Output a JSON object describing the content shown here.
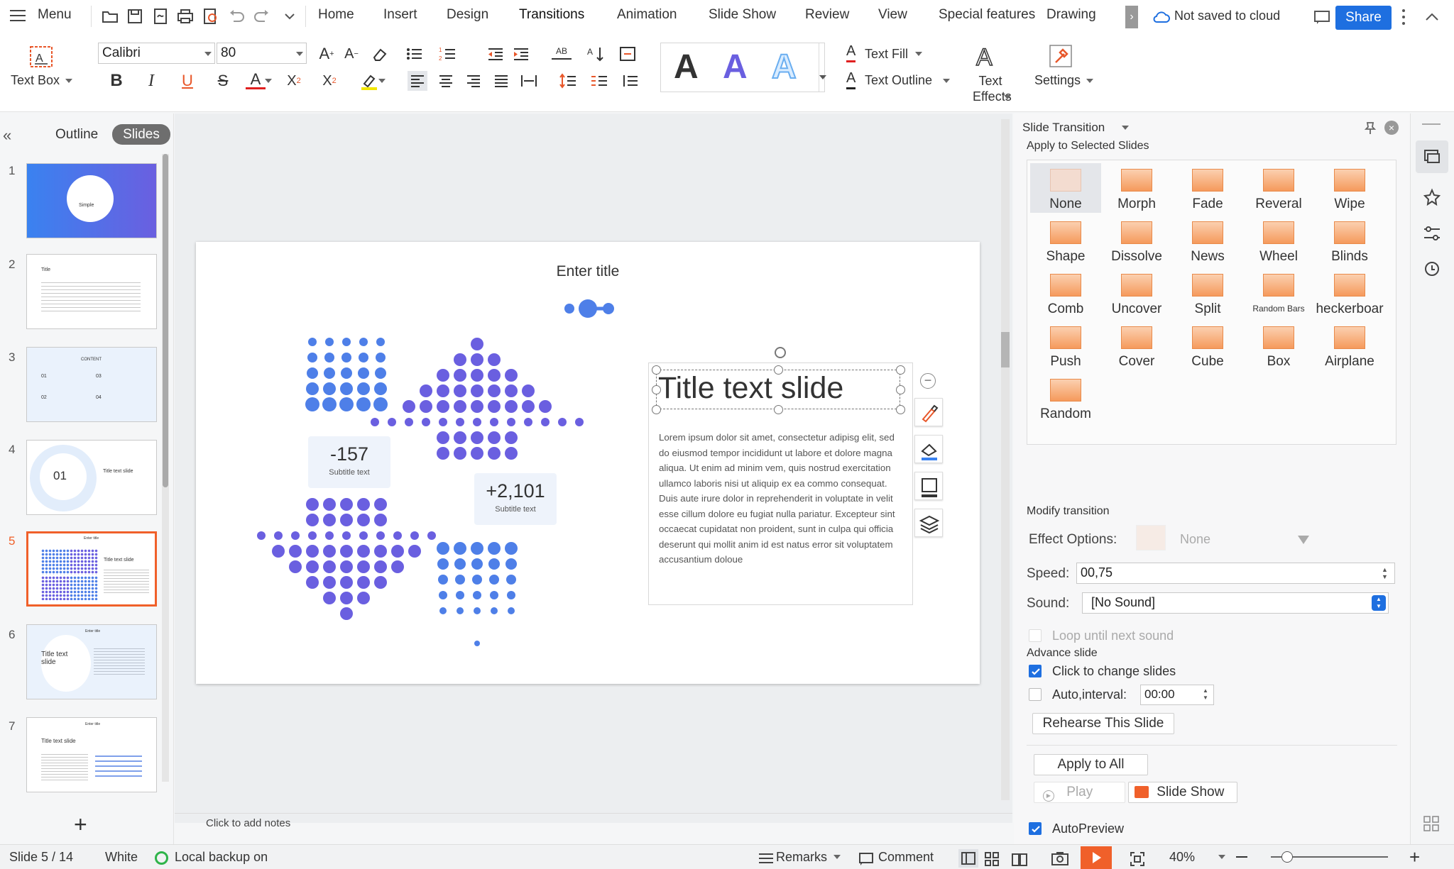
{
  "topbar": {
    "menu_label": "Menu",
    "tabs": [
      "Home",
      "Insert",
      "Design",
      "Transitions",
      "Animation",
      "Slide Show",
      "Review",
      "View",
      "Special features",
      "Drawing"
    ],
    "cloud_status": "Not saved to cloud",
    "share_label": "Share"
  },
  "ribbon": {
    "textbox_label": "Text Box",
    "font_name": "Calibri",
    "font_size": "80",
    "text_fill_label": "Text Fill",
    "text_outline_label": "Text Outline",
    "text_effects_label": "Text Effects",
    "settings_label": "Settings",
    "wordart_sample": "A"
  },
  "leftpanel": {
    "tab_outline": "Outline",
    "tab_slides": "Slides",
    "thumb_numbers": [
      "1",
      "2",
      "3",
      "4",
      "5",
      "6",
      "7"
    ],
    "thumb_texts": {
      "t1": "Simple",
      "t2": "Title",
      "t3": "CONTENT",
      "t3_items": [
        "01",
        "03",
        "02",
        "04"
      ],
      "t4_num": "01",
      "t4_title": "Title text slide",
      "t5_title": "Title text slide",
      "t5_head": "Enter title",
      "t6_head": "Enter title",
      "t6_title": "Title text slide",
      "t7_head": "Enter title",
      "t7_title": "Title text slide"
    }
  },
  "slide": {
    "title": "Enter title",
    "stat1_value": "-157",
    "stat1_label": "Subtitle text",
    "stat2_value": "+2,101",
    "stat2_label": "Subtitle text",
    "textbox_title": "Title text slide",
    "body": "Lorem ipsum dolor sit amet, consectetur adipisg elit, sed do eiusmod tempor incididunt ut labore et dolore magna aliqua. Ut enim ad minim vem, quis nostrud exercitation ullamco laboris nisi ut aliquip ex ea commo consequat. Duis aute irure dolor in reprehenderit in voluptate in velit esse cillum dolore eu fugiat nulla pariatur. Excepteur sint occaecat cupidatat non proident, sunt in culpa qui officia deserunt qui mollit anim id est natus error sit voluptatem accusantium doloue",
    "notes_placeholder": "Click to add notes"
  },
  "transition_panel": {
    "title": "Slide Transition",
    "apply_selected": "Apply to Selected Slides",
    "effects": [
      "None",
      "Morph",
      "Fade",
      "Reveral",
      "Wipe",
      "Shape",
      "Dissolve",
      "News",
      "Wheel",
      "Blinds",
      "Comb",
      "Uncover",
      "Split",
      "Random Bars",
      "heckerboar",
      "Push",
      "Cover",
      "Cube",
      "Box",
      "Airplane",
      "Random"
    ],
    "modify_label": "Modify transition",
    "effect_options_label": "Effect Options:",
    "effect_options_value": "None",
    "speed_label": "Speed:",
    "speed_value": "00,75",
    "sound_label": "Sound:",
    "sound_value": "[No Sound]",
    "loop_label": "Loop until next sound",
    "advance_label": "Advance slide",
    "click_change_label": "Click to change slides",
    "auto_interval_label": "Auto,interval:",
    "auto_interval_value": "00:00",
    "rehearse_label": "Rehearse This Slide",
    "apply_all_label": "Apply to All",
    "play_label": "Play",
    "slideshow_label": "Slide Show",
    "autopreview_label": "AutoPreview"
  },
  "statusbar": {
    "slide_counter": "Slide 5 / 14",
    "theme": "White",
    "backup": "Local backup on",
    "remarks": "Remarks",
    "comment": "Comment",
    "zoom": "40%"
  },
  "colors": {
    "accent": "#1e6fe0",
    "orange": "#f0602a",
    "dot_blue": "#4e7fe8",
    "dot_purple": "#6a5fe0"
  }
}
